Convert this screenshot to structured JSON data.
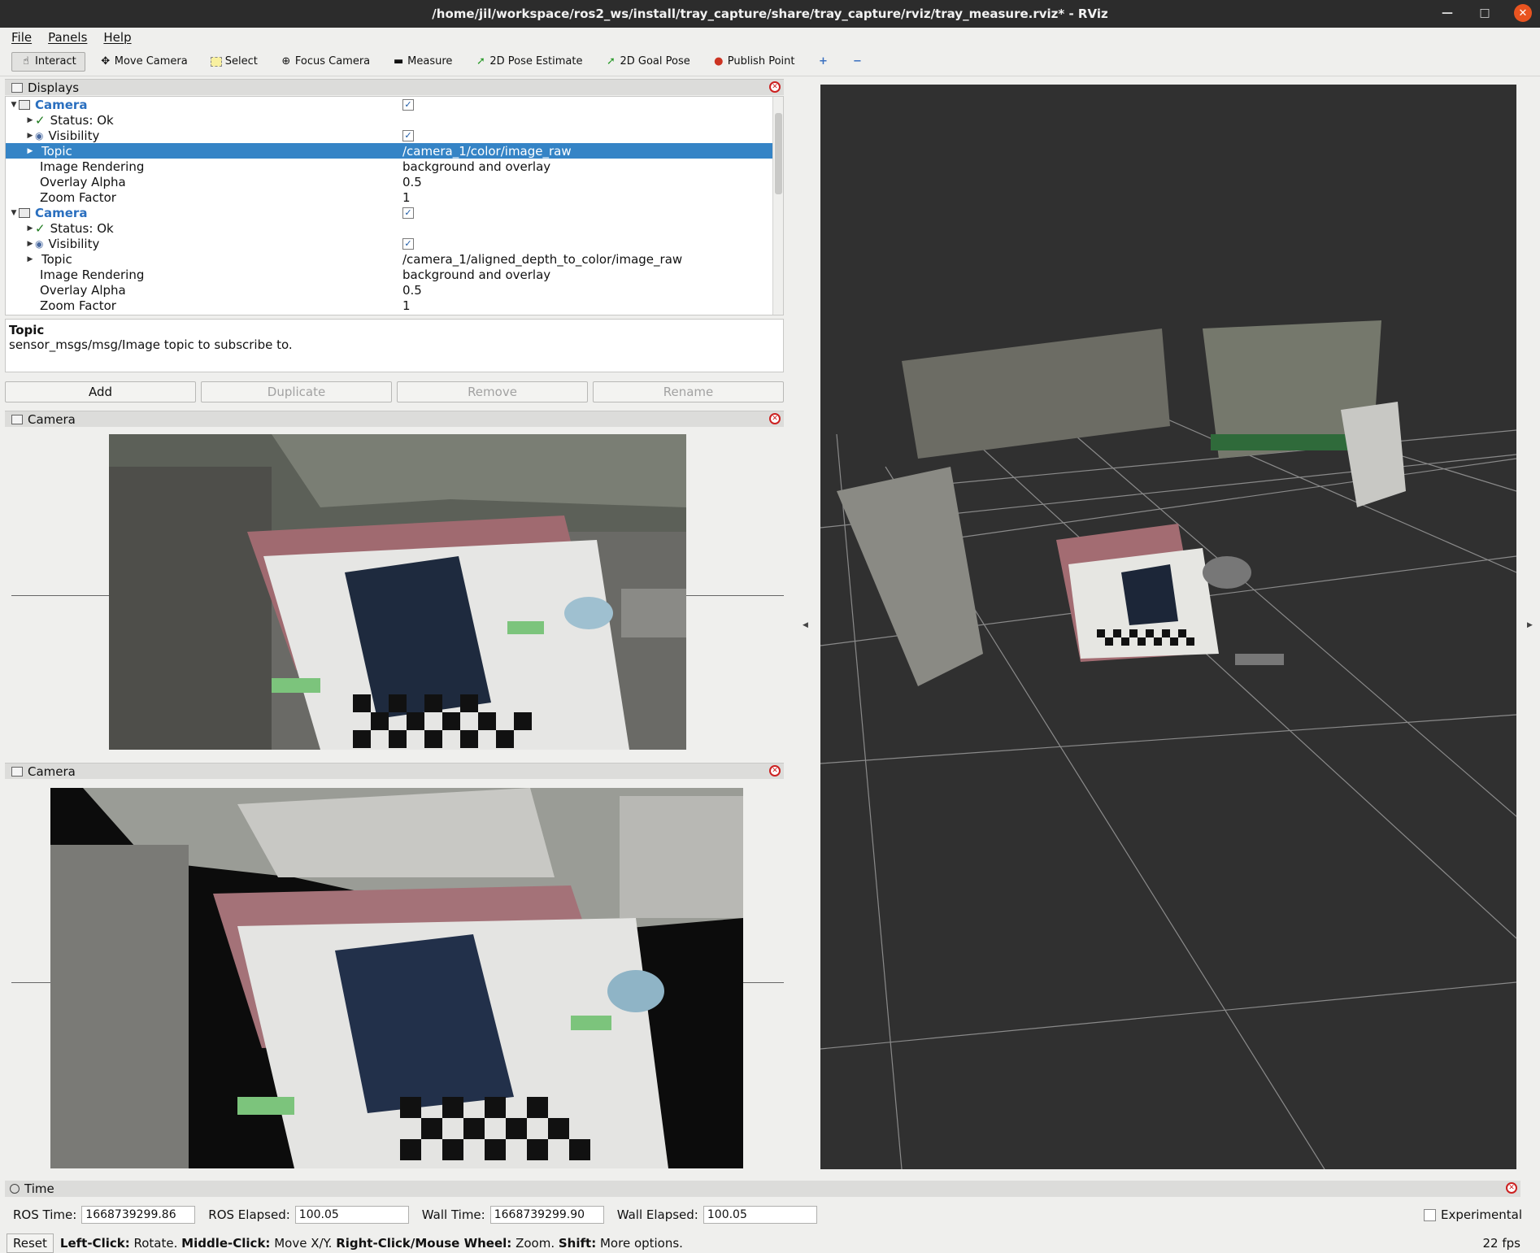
{
  "window": {
    "title": "/home/jil/workspace/ros2_ws/install/tray_capture/share/tray_capture/rviz/tray_measure.rviz* - RViz"
  },
  "menu": {
    "file": "File",
    "panels": "Panels",
    "help": "Help"
  },
  "toolbar": {
    "interact": "Interact",
    "move_camera": "Move Camera",
    "select": "Select",
    "focus_camera": "Focus Camera",
    "measure": "Measure",
    "pose_estimate": "2D Pose Estimate",
    "goal_pose": "2D Goal Pose",
    "publish_point": "Publish Point"
  },
  "displays": {
    "title": "Displays",
    "cameras": [
      {
        "name": "Camera",
        "status": "Status: Ok",
        "visibility_label": "Visibility",
        "topic_label": "Topic",
        "topic": "/camera_1/color/image_raw",
        "rendering_label": "Image Rendering",
        "rendering": "background and overlay",
        "alpha_label": "Overlay Alpha",
        "alpha": "0.5",
        "zoom_label": "Zoom Factor",
        "zoom": "1"
      },
      {
        "name": "Camera",
        "status": "Status: Ok",
        "visibility_label": "Visibility",
        "topic_label": "Topic",
        "topic": "/camera_1/aligned_depth_to_color/image_raw",
        "rendering_label": "Image Rendering",
        "rendering": "background and overlay",
        "alpha_label": "Overlay Alpha",
        "alpha": "0.5",
        "zoom_label": "Zoom Factor",
        "zoom": "1"
      }
    ]
  },
  "help_box": {
    "title": "Topic",
    "text": "sensor_msgs/msg/Image topic to subscribe to."
  },
  "buttons": {
    "add": "Add",
    "duplicate": "Duplicate",
    "remove": "Remove",
    "rename": "Rename"
  },
  "camera_panels": [
    {
      "title": "Camera"
    },
    {
      "title": "Camera"
    }
  ],
  "time": {
    "title": "Time",
    "ros_time_label": "ROS Time:",
    "ros_time": "1668739299.86",
    "ros_elapsed_label": "ROS Elapsed:",
    "ros_elapsed": "100.05",
    "wall_time_label": "Wall Time:",
    "wall_time": "1668739299.90",
    "wall_elapsed_label": "Wall Elapsed:",
    "wall_elapsed": "100.05",
    "experimental": "Experimental"
  },
  "status": {
    "reset": "Reset",
    "left_click": "Left-Click:",
    "rotate": "Rotate.",
    "middle_click": "Middle-Click:",
    "move": "Move X/Y.",
    "right_click": "Right-Click/Mouse Wheel:",
    "zoom": "Zoom.",
    "shift": "Shift:",
    "more": "More options.",
    "fps": "22 fps"
  },
  "colors": {
    "selection": "#3584c6",
    "view_bg": "#303030",
    "close_red": "#cc2020"
  }
}
